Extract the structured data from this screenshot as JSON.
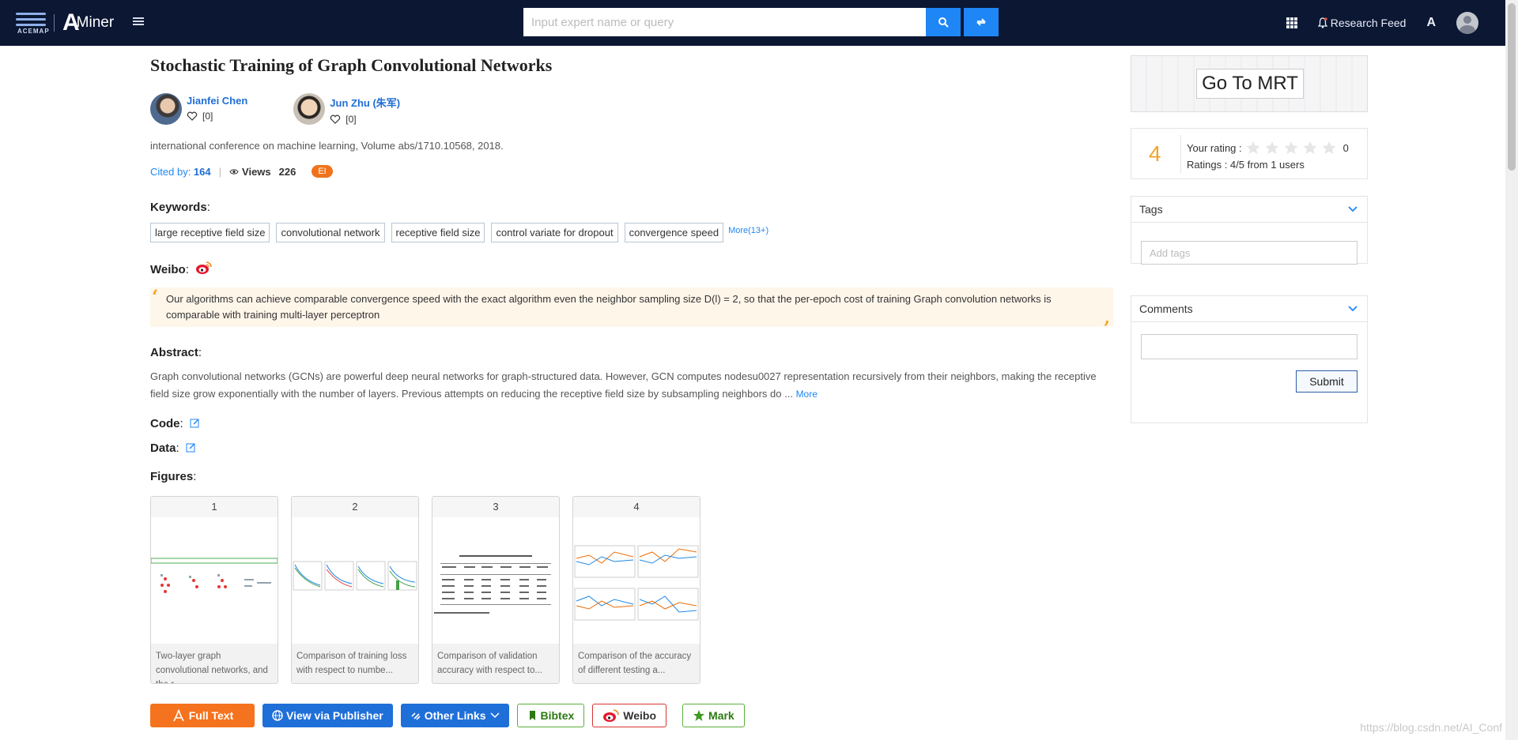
{
  "header": {
    "brand_small": "ACEMAP",
    "brand": "Miner",
    "brand_glyph": "A",
    "search_placeholder": "Input expert name or query",
    "research_feed": "Research Feed",
    "lang_glyph": "A",
    "colors": {
      "bar": "#0b1733",
      "accent": "#1f86f5"
    }
  },
  "paper": {
    "title": "Stochastic Training of Graph Convolutional Networks",
    "authors": [
      {
        "name": "Jianfei Chen",
        "follow": "[0]"
      },
      {
        "name": "Jun Zhu (朱军)",
        "follow": "[0]"
      }
    ],
    "venue": "international conference on machine learning, Volume abs/1710.10568, 2018.",
    "cited_label": "Cited by: ",
    "cited_count": "164",
    "separator": "|",
    "views_label": "Views",
    "views_count": "226",
    "badge": "EI"
  },
  "keywords": {
    "label": "Keywords",
    "items": [
      "large receptive field size",
      "convolutional network",
      "receptive field size",
      "control variate for dropout",
      "convergence speed"
    ],
    "more": "More(13+)"
  },
  "weibo": {
    "label": "Weibo",
    "quote": "Our algorithms can achieve comparable convergence speed with the exact algorithm even the neighbor sampling size D(l) = 2, so that the per-epoch cost of training Graph convolution networks is comparable with training multi-layer perceptron"
  },
  "abstract": {
    "label": "Abstract",
    "text": "Graph convolutional networks (GCNs) are powerful deep neural networks for graph-structured data. However, GCN computes nodesu0027 representation recursively from their neighbors, making the receptive field size grow exponentially with the number of layers. Previous attempts on reducing the receptive field size by subsampling neighbors do ...",
    "more": "More"
  },
  "code_label": "Code",
  "data_label": "Data",
  "figures": {
    "label": "Figures",
    "items": [
      {
        "num": "1",
        "caption": "Two-layer graph convolutional networks, and the r..."
      },
      {
        "num": "2",
        "caption": "Comparison of training loss with respect to numbe..."
      },
      {
        "num": "3",
        "caption": "Comparison of validation accuracy with respect to..."
      },
      {
        "num": "4",
        "caption": "Comparison of the accuracy of different testing a..."
      }
    ]
  },
  "actions": {
    "full_text": "Full Text",
    "publisher": "View via Publisher",
    "other_links": "Other Links",
    "bibtex": "Bibtex",
    "weibo": "Weibo",
    "mark": "Mark"
  },
  "sidebar": {
    "mrt": "Go To MRT",
    "rating_score": "4",
    "your_rating_label": "Your rating :",
    "your_rating_value": "0",
    "stars_total": 5,
    "ratings_summary": "Ratings : 4/5 from 1 users",
    "tags_title": "Tags",
    "tags_placeholder": "Add tags",
    "comments_title": "Comments",
    "submit": "Submit"
  },
  "watermark": "https://blog.csdn.net/AI_Conf"
}
